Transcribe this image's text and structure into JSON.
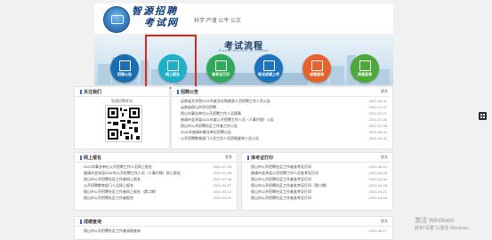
{
  "header": {
    "logo_line1": "智源招聘",
    "logo_line2": "考试网",
    "slogan": "科学 严谨 公平 公正"
  },
  "banner": {
    "title": "考试流程",
    "subtitle": "Examination process",
    "steps": [
      {
        "label": "招聘公告",
        "color": "#1a6fb3",
        "icon": "announcement-icon"
      },
      {
        "label": "网上报名",
        "color": "#1fb0c8",
        "icon": "edit-icon"
      },
      {
        "label": "准考证打印",
        "color": "#2faa5a",
        "icon": "print-icon"
      },
      {
        "label": "笔试成绩上传",
        "color": "#1e73be",
        "icon": "upload-icon"
      },
      {
        "label": "成绩查询",
        "color": "#e5622f",
        "icon": "search-icon"
      },
      {
        "label": "资格复审",
        "color": "#4fa83a",
        "icon": "check-icon"
      }
    ]
  },
  "wechat": {
    "title": "关注我们",
    "caption": "智源招聘考试"
  },
  "notices": {
    "title": "招聘公告",
    "more": "更多",
    "items": [
      {
        "text": "云南省文学院2021年度文化和旅游人员招聘工作人员公告",
        "date": "2021-01-11"
      },
      {
        "text": "云南省保山市学位招聘",
        "date": "2021-07-07"
      },
      {
        "text": "保山市事业单位公开招聘工作人员简章",
        "date": "2021-07-07"
      },
      {
        "text": "曲靖市会泽县2021年度公开招聘工作人员（人事代理）公告",
        "date": "2021-07-06"
      },
      {
        "text": "保山市公开招聘社区工作者工作公告",
        "date": "2021-07-06"
      },
      {
        "text": "2021年曲靖市事业单位招聘公告",
        "date": "2021-06-11"
      },
      {
        "text": "公开招聘教育部门人员工作人员资格复审人员公告",
        "date": "2021-05-11"
      }
    ]
  },
  "online": {
    "title": "网上报名",
    "more": "更多",
    "items": [
      {
        "text": "2021年事业单位公开招聘工作人员网上报名",
        "date": "2021-07-08"
      },
      {
        "text": "曲靖市会泽县2021年公开招聘工作人员（人事代理）网上报名",
        "date": "2021-07-06"
      },
      {
        "text": "保山市公开招聘社区工作者网上报名",
        "date": "2021-07-06"
      },
      {
        "text": "公开招聘教育部门人员网上报名",
        "date": "2021-04-27"
      },
      {
        "text": "保山市公开招聘社区工作者网上报名（第二期）",
        "date": "2021-04-12"
      },
      {
        "text": "保山市公开招聘社区工作者报名",
        "date": "2021-04-01"
      }
    ]
  },
  "admit": {
    "title": "准考证打印",
    "more": "更多",
    "items": [
      {
        "text": "保山市公开招聘社区工作者准考证打印",
        "date": "2021-05-12"
      },
      {
        "text": "曲靖市会泽县公开招聘工作人员准考证打印",
        "date": "2021-05-06"
      },
      {
        "text": "保山市公开招聘社区工作者准考证打印",
        "date": "2021-04-30"
      },
      {
        "text": "保山市公开招聘社区工作者准考证打印（第二期）",
        "date": "2021-04-28"
      },
      {
        "text": "保山市公开招聘社区工作者准考证打印",
        "date": "2021-04-21"
      },
      {
        "text": "保山市公开招聘社区工作者准考证打印",
        "date": "2021-04-08"
      }
    ]
  },
  "scores": {
    "title": "成绩查询",
    "more": "更多",
    "items": [
      {
        "text": "保山市公开招聘社区工作者成绩查询",
        "date": "2021-06-17"
      }
    ]
  },
  "watermark": {
    "line1": "激活 Windows",
    "line2": "转到“设置”以激活 Windows。"
  }
}
